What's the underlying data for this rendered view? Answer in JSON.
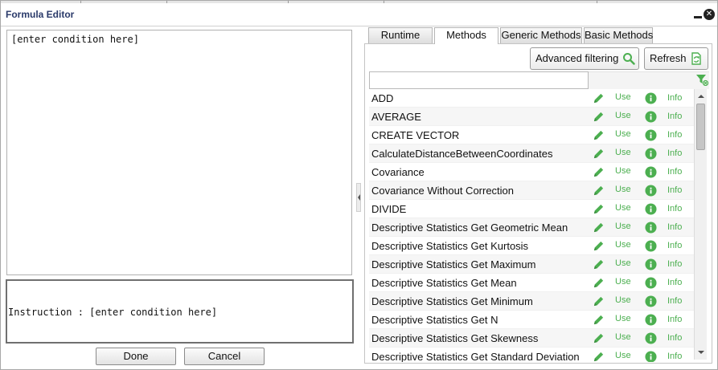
{
  "window": {
    "title": "Formula Editor"
  },
  "editor": {
    "text": "[enter condition here]"
  },
  "instruction": {
    "text": "Instruction : [enter condition here]"
  },
  "buttons": {
    "done": "Done",
    "cancel": "Cancel"
  },
  "tabs": [
    {
      "label": "Runtime",
      "active": false
    },
    {
      "label": "Methods",
      "active": true
    },
    {
      "label": "Generic Methods",
      "active": false
    },
    {
      "label": "Basic Methods",
      "active": false
    }
  ],
  "toolbar": {
    "advanced_filtering": "Advanced filtering",
    "refresh": "Refresh"
  },
  "filter": {
    "value": ""
  },
  "row_actions": {
    "use": "Use",
    "info": "Info"
  },
  "methods": [
    "ADD",
    "AVERAGE",
    "CREATE VECTOR",
    "CalculateDistanceBetweenCoordinates",
    "Covariance",
    "Covariance Without Correction",
    "DIVIDE",
    "Descriptive Statistics Get Geometric Mean",
    "Descriptive Statistics Get Kurtosis",
    "Descriptive Statistics Get Maximum",
    "Descriptive Statistics Get Mean",
    "Descriptive Statistics Get Minimum",
    "Descriptive Statistics Get N",
    "Descriptive Statistics Get Skewness",
    "Descriptive Statistics Get Standard Deviation"
  ],
  "colors": {
    "accent_green": "#4caf50",
    "title_text": "#2a3a6a"
  }
}
